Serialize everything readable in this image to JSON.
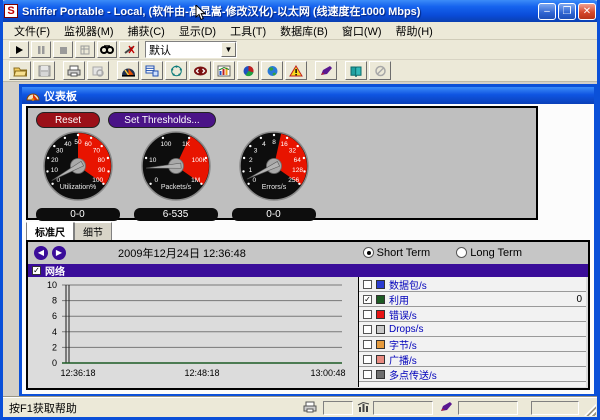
{
  "window": {
    "title": "Sniffer Portable - Local, (软件由-高显嵩-修改汉化)-以太网 (线速度在1000 Mbps)",
    "minimize": "–",
    "maximize": "❐",
    "close": "✕"
  },
  "menu": {
    "items": [
      "文件(F)",
      "监视器(M)",
      "捕获(C)",
      "显示(D)",
      "工具(T)",
      "数据库(B)",
      "窗口(W)",
      "帮助(H)"
    ]
  },
  "toolbar": {
    "filter_value": "默认"
  },
  "dashboard": {
    "title": "仪表板",
    "reset_label": "Reset",
    "thresholds_label": "Set Thresholds...",
    "tabs": [
      "标准尺",
      "细节"
    ]
  },
  "gauges": [
    {
      "label": "Utilization%",
      "value": "0-0",
      "ticks": [
        "0",
        "10",
        "20",
        "30",
        "40",
        "50",
        "60",
        "70",
        "80",
        "90",
        "100"
      ],
      "red_start_index": 5,
      "needle_bearing": -119
    },
    {
      "label": "Packets/s",
      "value": "6-535",
      "ticks": [
        "0",
        "10",
        "100",
        "1K",
        "100K",
        "1M"
      ],
      "red_start_index": 3,
      "needle_bearing": -94
    },
    {
      "label": "Errors/s",
      "value": "0-0",
      "ticks": [
        "0",
        "1",
        "2",
        "3",
        "4",
        "8",
        "16",
        "32",
        "64",
        "128",
        "256"
      ],
      "red_start_index": 5.5,
      "needle_bearing": -116
    }
  ],
  "monitor": {
    "date": "2009年12月24日  12:36:48",
    "short_term": "Short Term",
    "long_term": "Long Term",
    "group_label": "网络",
    "legend": [
      {
        "label": "数据包/s",
        "color": "#2A3BD0",
        "checked": false,
        "value": ""
      },
      {
        "label": "利用",
        "color": "#1D5B24",
        "checked": true,
        "value": "0"
      },
      {
        "label": "错误/s",
        "color": "#E81414",
        "checked": false,
        "value": ""
      },
      {
        "label": "Drops/s",
        "color": "#C8C8C8",
        "checked": false,
        "value": ""
      },
      {
        "label": "字节/s",
        "color": "#E59A3C",
        "checked": false,
        "value": ""
      },
      {
        "label": "广播/s",
        "color": "#E88A80",
        "checked": false,
        "value": ""
      },
      {
        "label": "多点传送/s",
        "color": "#6E6E6E",
        "checked": false,
        "value": ""
      }
    ]
  },
  "chart_data": {
    "type": "line",
    "title": "",
    "xlabel": "",
    "ylabel": "",
    "ylim": [
      0,
      10
    ],
    "yticks": [
      0,
      2,
      4,
      6,
      8,
      10
    ],
    "x_labels": [
      "12:36:18",
      "12:48:18",
      "13:00:48"
    ],
    "grid": true,
    "legend_position": "right",
    "series": [
      {
        "name": "利用",
        "color": "#1D5B24",
        "values": [
          0,
          0,
          0
        ]
      }
    ]
  },
  "status": {
    "help": "按F1获取帮助"
  },
  "colors": {
    "titlebar": "#0A4BD8",
    "panel_gray": "#BFBFBF",
    "accent_purple": "#3A0D99",
    "reset_red": "#9B1018",
    "thresholds_purple": "#4A1387",
    "gauge_red": "#E81400"
  }
}
